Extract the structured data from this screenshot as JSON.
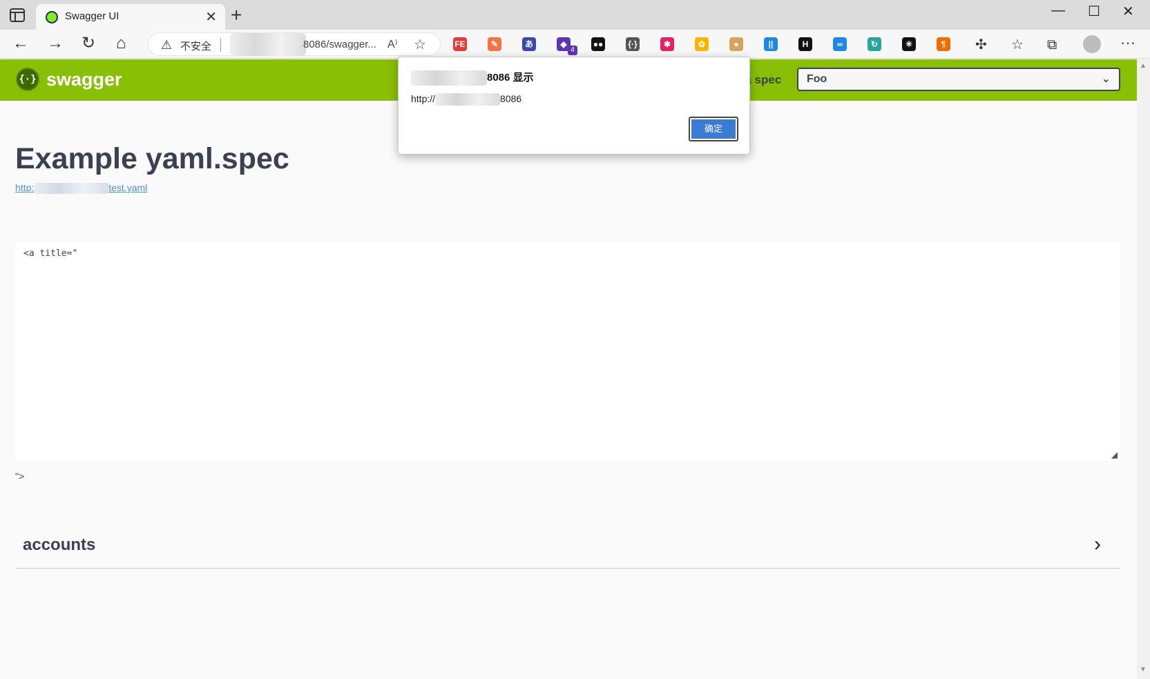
{
  "browser": {
    "tab_title": "Swagger UI",
    "tab_close": "✕",
    "new_tab": "+",
    "address": {
      "security_label": "不安全",
      "url_visible": "8086/swagger...",
      "read_aloud": "A⁾"
    },
    "window_controls": {
      "minimize": "—",
      "maximize": "☐",
      "close": "✕"
    },
    "extensions": [
      {
        "icon": "fe-helper-icon",
        "glyph": "FE",
        "color": "#e53935"
      },
      {
        "icon": "paint-icon",
        "glyph": "✎",
        "color": "#ff7043"
      },
      {
        "icon": "translate-icon",
        "glyph": "あ",
        "color": "#3949ab"
      },
      {
        "icon": "cube-ext-icon",
        "glyph": "◆",
        "color": "#5e35b1"
      },
      {
        "icon": "toggle-ext-icon",
        "glyph": "●●",
        "color": "#111111"
      },
      {
        "icon": "braces-ext-icon",
        "glyph": "{·}",
        "color": "#555555"
      },
      {
        "icon": "star-ext-icon",
        "glyph": "✱",
        "color": "#e91e63"
      },
      {
        "icon": "flower-ext-icon",
        "glyph": "✿",
        "color": "#ffb300"
      },
      {
        "icon": "cookie-icon",
        "glyph": "●",
        "color": "#d7a35b"
      },
      {
        "icon": "bars-ext-icon",
        "glyph": "||",
        "color": "#1e88e5"
      },
      {
        "icon": "h-ext-icon",
        "glyph": "H",
        "color": "#111111"
      },
      {
        "icon": "mask-ext-icon",
        "glyph": "∞",
        "color": "#1e88e5"
      },
      {
        "icon": "refresh-ext-icon",
        "glyph": "↻",
        "color": "#26a69a"
      },
      {
        "icon": "color-ext-icon",
        "glyph": "✳",
        "color": "#111111"
      },
      {
        "icon": "pilcrow-ext-icon",
        "glyph": "¶",
        "color": "#ef6c00"
      }
    ],
    "extension_badge": "4",
    "more": "···"
  },
  "swagger": {
    "brand": "swagger",
    "select_label": "t a spec",
    "selected_spec": "Foo",
    "info_title": "Example yaml.spec",
    "spec_link_prefix": "http:",
    "spec_link_suffix": "test.yaml",
    "description_code": "<a title=\"",
    "description_after": "\">",
    "tags": [
      {
        "name": "accounts"
      }
    ]
  },
  "dialog": {
    "title_suffix": "8086 显示",
    "message_prefix": "http://",
    "message_suffix": "8086",
    "ok_label": "确定"
  }
}
